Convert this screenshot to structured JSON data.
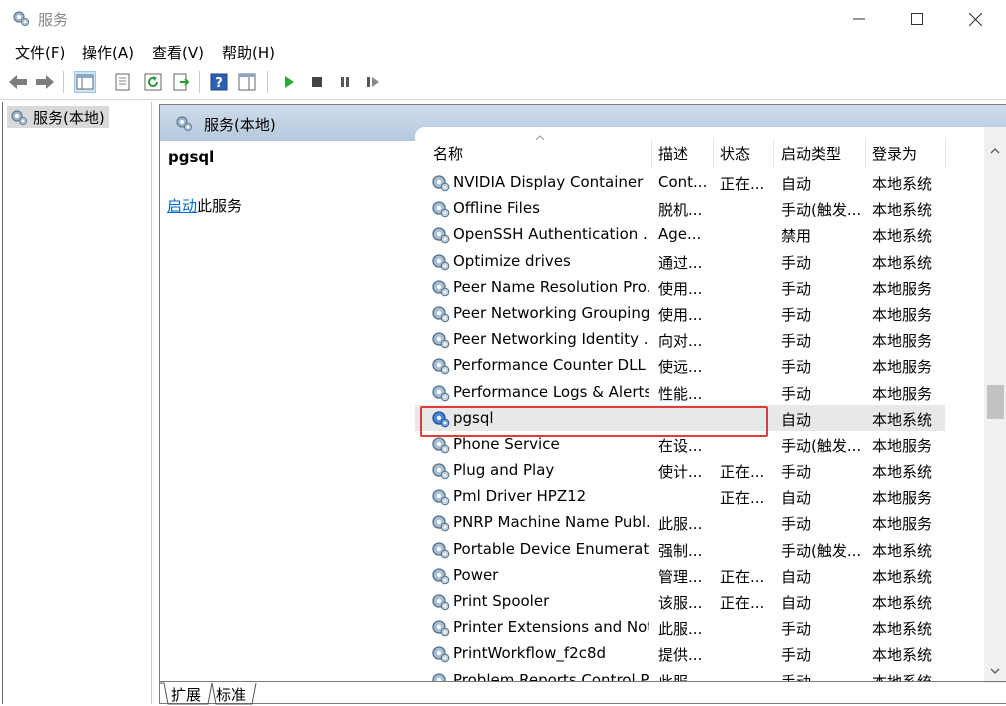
{
  "window": {
    "title": "服务"
  },
  "menu": [
    "文件(F)",
    "操作(A)",
    "查看(V)",
    "帮助(H)"
  ],
  "toolbar": {
    "icons": [
      "back-icon",
      "forward-icon",
      "show-hide-tree-icon",
      "properties-icon",
      "refresh-icon",
      "export-list-icon",
      "help-icon",
      "show-action-pane-icon",
      "play-icon",
      "stop-icon",
      "pause-icon",
      "restart-icon"
    ]
  },
  "tree": {
    "root_label": "服务(本地)"
  },
  "panel": {
    "header_title": "服务(本地)",
    "selected_service": "pgsql",
    "start_link": "启动",
    "start_suffix": "此服务"
  },
  "columns": [
    "名称",
    "描述",
    "状态",
    "启动类型",
    "登录为"
  ],
  "services": [
    {
      "name": "NVIDIA Display Container LS",
      "desc": "Cont...",
      "status": "正在...",
      "startup": "自动",
      "logon": "本地系统"
    },
    {
      "name": "Offline Files",
      "desc": "脱机...",
      "status": "",
      "startup": "手动(触发...",
      "logon": "本地系统"
    },
    {
      "name": "OpenSSH Authentication ...",
      "desc": "Age...",
      "status": "",
      "startup": "禁用",
      "logon": "本地系统"
    },
    {
      "name": "Optimize drives",
      "desc": "通过...",
      "status": "",
      "startup": "手动",
      "logon": "本地系统"
    },
    {
      "name": "Peer Name Resolution Pro...",
      "desc": "使用...",
      "status": "",
      "startup": "手动",
      "logon": "本地服务"
    },
    {
      "name": "Peer Networking Grouping",
      "desc": "使用...",
      "status": "",
      "startup": "手动",
      "logon": "本地服务"
    },
    {
      "name": "Peer Networking Identity ...",
      "desc": "向对...",
      "status": "",
      "startup": "手动",
      "logon": "本地服务"
    },
    {
      "name": "Performance Counter DLL ...",
      "desc": "使远...",
      "status": "",
      "startup": "手动",
      "logon": "本地服务"
    },
    {
      "name": "Performance Logs & Alerts",
      "desc": "性能...",
      "status": "",
      "startup": "手动",
      "logon": "本地服务"
    },
    {
      "name": "pgsql",
      "desc": "",
      "status": "",
      "startup": "自动",
      "logon": "本地系统",
      "selected": true
    },
    {
      "name": "Phone Service",
      "desc": "在设...",
      "status": "",
      "startup": "手动(触发...",
      "logon": "本地服务"
    },
    {
      "name": "Plug and Play",
      "desc": "使计...",
      "status": "正在...",
      "startup": "手动",
      "logon": "本地系统"
    },
    {
      "name": "Pml Driver HPZ12",
      "desc": "",
      "status": "正在...",
      "startup": "自动",
      "logon": "本地服务"
    },
    {
      "name": "PNRP Machine Name Publ...",
      "desc": "此服...",
      "status": "",
      "startup": "手动",
      "logon": "本地服务"
    },
    {
      "name": "Portable Device Enumerat...",
      "desc": "强制...",
      "status": "",
      "startup": "手动(触发...",
      "logon": "本地系统"
    },
    {
      "name": "Power",
      "desc": "管理...",
      "status": "正在...",
      "startup": "自动",
      "logon": "本地系统"
    },
    {
      "name": "Print Spooler",
      "desc": "该服...",
      "status": "正在...",
      "startup": "自动",
      "logon": "本地系统"
    },
    {
      "name": "Printer Extensions and Noti...",
      "desc": "此服...",
      "status": "",
      "startup": "手动",
      "logon": "本地系统"
    },
    {
      "name": "PrintWorkflow_f2c8d",
      "desc": "提供...",
      "status": "",
      "startup": "手动",
      "logon": "本地系统"
    },
    {
      "name": "Problem Reports Control P...",
      "desc": "此服...",
      "status": "",
      "startup": "手动",
      "logon": "本地系统"
    }
  ],
  "tabs": [
    "扩展",
    "标准"
  ]
}
